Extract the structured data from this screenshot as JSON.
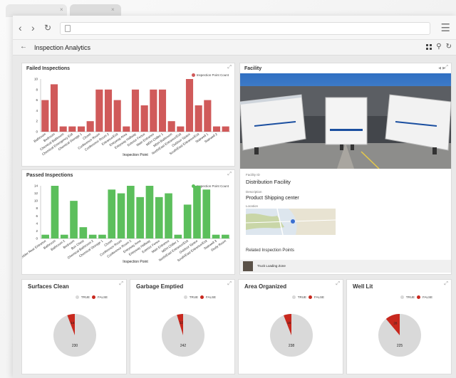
{
  "browser": {
    "close_glyph": "×"
  },
  "app": {
    "title": "Inspection Analytics"
  },
  "failed": {
    "title": "Failed Inspections",
    "legend": "Inspection Point Count",
    "color": "#d05a5a",
    "yticks": [
      "0",
      "2",
      "4",
      "6",
      "8",
      "10"
    ],
    "xlabel": "Inspection Point",
    "chart_data": {
      "type": "bar",
      "categories": [
        "Bathroom",
        "Bedroom",
        "Chemical Bathroom",
        "Chemical Emergency Exit",
        "Chemical Storage 1",
        "Closet",
        "Conference Room",
        "Conference Room 2",
        "Entrance/Exit",
        "Entryway Area",
        "Entryway Hallway",
        "Exterior Fence",
        "Main Entrance",
        "MDH Chiller 1",
        "MDH Bathroom",
        "North/East Entrance/Exit",
        "Outdoor Space",
        "South/East Entrance/Exit",
        "Stairwell 1",
        "Stairwell 2"
      ],
      "values": [
        6,
        9,
        1,
        1,
        1,
        2,
        8,
        8,
        6,
        1,
        8,
        5,
        8,
        8,
        2,
        1,
        10,
        5,
        6,
        1,
        1
      ],
      "ylim": [
        0,
        10
      ]
    }
  },
  "passed": {
    "title": "Passed Inspections",
    "legend": "Inspection Point Count",
    "color": "#5cbf5c",
    "yticks": [
      "0",
      "2",
      "4",
      "6",
      "8",
      "10",
      "12",
      "14"
    ],
    "xlabel": "Inspection Point",
    "chart_data": {
      "type": "bar",
      "categories": [
        "Assembler Rear Entrance",
        "Bathroom",
        "Bathroom 2",
        "Bedroom",
        "Box Chest",
        "Chemical Bathroom 2",
        "Chemical Storage 1",
        "Closet",
        "Conference Room",
        "Conference Room 2",
        "Entryway Area",
        "Entryway Hallway",
        "Exterior Fence",
        "Main Entrance",
        "MDH Chiller 1",
        "North/East Entrance/Exit",
        "Outdoor Space",
        "South/East Entrance/Exit",
        "Stairwell 3",
        "Study Room"
      ],
      "values": [
        1,
        14,
        1,
        10,
        3,
        1,
        1,
        13,
        12,
        14,
        11,
        14,
        11,
        12,
        1,
        9,
        14,
        13,
        1,
        1
      ],
      "ylim": [
        0,
        14
      ]
    }
  },
  "facility": {
    "title": "Facility",
    "id_label": "Facility ID",
    "id_value": "Distribution Facility",
    "desc_label": "Description",
    "desc_value": "Product Shipping center",
    "loc_label": "Location",
    "related_title": "Related Inspection Points",
    "related_item": "Truck Loading Zone",
    "prev": "◀",
    "next": "▶"
  },
  "kpis": [
    {
      "title": "Surfaces Clean",
      "true_label": "TRUE",
      "false_label": "FALSE",
      "true_value": 230,
      "false_value": 14
    },
    {
      "title": "Garbage Emptied",
      "true_label": "TRUE",
      "false_label": "FALSE",
      "true_value": 242,
      "false_value": 12
    },
    {
      "title": "Area Organized",
      "true_label": "TRUE",
      "false_label": "FALSE",
      "true_value": 238,
      "false_value": 15
    },
    {
      "title": "Well Lit",
      "true_label": "TRUE",
      "false_label": "FALSE",
      "true_value": 225,
      "false_value": 28
    }
  ],
  "colors": {
    "true": "#d9d9d9",
    "false": "#c8281e"
  }
}
